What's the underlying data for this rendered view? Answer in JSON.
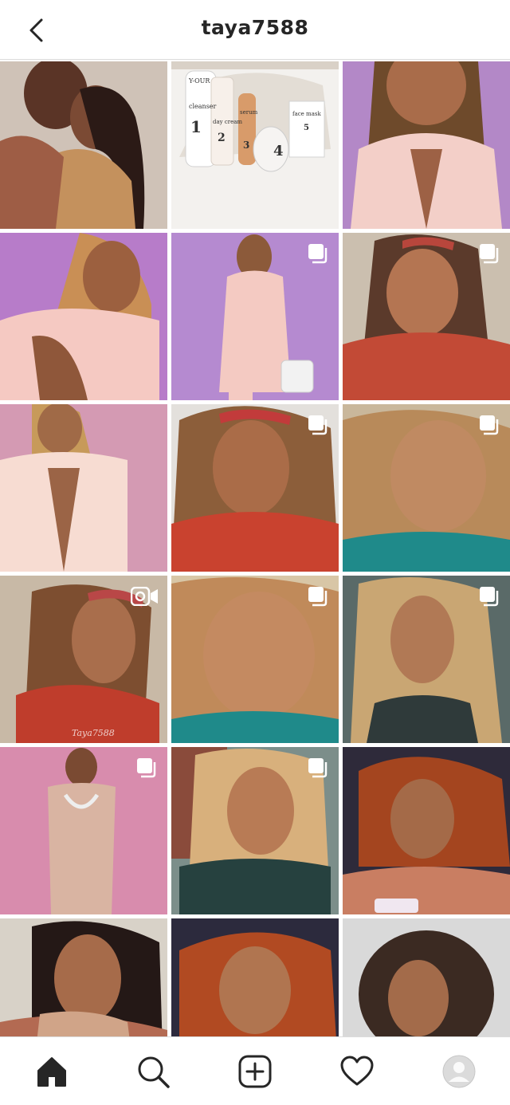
{
  "header": {
    "username": "taya7588",
    "back_icon": "chevron-left-icon"
  },
  "grid": {
    "rows": [
      [
        {
          "kind": "photo",
          "desc": "couple-scarf",
          "multi": false
        },
        {
          "kind": "product",
          "labels": [
            "Y-OUR",
            "cleanser",
            "1",
            "day cream",
            "2",
            "serum",
            "3",
            "4",
            "face mask",
            "5"
          ],
          "multi": false
        },
        {
          "kind": "photo",
          "desc": "pink-blazer-closeup",
          "multi": false
        }
      ],
      [
        {
          "kind": "photo",
          "desc": "pink-blazer-purple-bg",
          "multi": false
        },
        {
          "kind": "photo",
          "desc": "pink-suit-full",
          "multi": true
        },
        {
          "kind": "photo",
          "desc": "red-top-headband",
          "multi": true
        }
      ],
      [
        {
          "kind": "photo",
          "desc": "pink-blazer-pink-bg",
          "multi": false
        },
        {
          "kind": "photo",
          "desc": "curly-hair-smile",
          "multi": true
        },
        {
          "kind": "photo",
          "desc": "teal-top-glam",
          "multi": true
        }
      ],
      [
        {
          "kind": "video",
          "desc": "red-top-straight-hair",
          "multi": false,
          "watermark": "Taya7588"
        },
        {
          "kind": "photo",
          "desc": "teal-glam-closeup",
          "multi": true
        },
        {
          "kind": "photo",
          "desc": "blonde-straight-hair",
          "multi": true
        }
      ],
      [
        {
          "kind": "photo",
          "desc": "pearl-necklace-dress",
          "multi": true
        },
        {
          "kind": "photo",
          "desc": "blonde-smile-chin",
          "multi": true
        },
        {
          "kind": "photo",
          "desc": "copper-hair-phone",
          "multi": false
        }
      ],
      [
        {
          "kind": "photo",
          "desc": "scarf-portrait",
          "multi": false
        },
        {
          "kind": "photo",
          "desc": "copper-hair-smile",
          "multi": false
        },
        {
          "kind": "photo",
          "desc": "curly-black-tee",
          "multi": false
        }
      ]
    ]
  },
  "bottom_nav": [
    {
      "name": "home-icon",
      "active": true
    },
    {
      "name": "search-icon",
      "active": false
    },
    {
      "name": "add-post-icon",
      "active": false
    },
    {
      "name": "heart-icon",
      "active": false
    },
    {
      "name": "profile-avatar-icon",
      "active": false
    }
  ],
  "colors": {
    "header_bg": "#ffffff",
    "text": "#262626",
    "divider": "#dbdbdb",
    "icon": "#262626"
  }
}
